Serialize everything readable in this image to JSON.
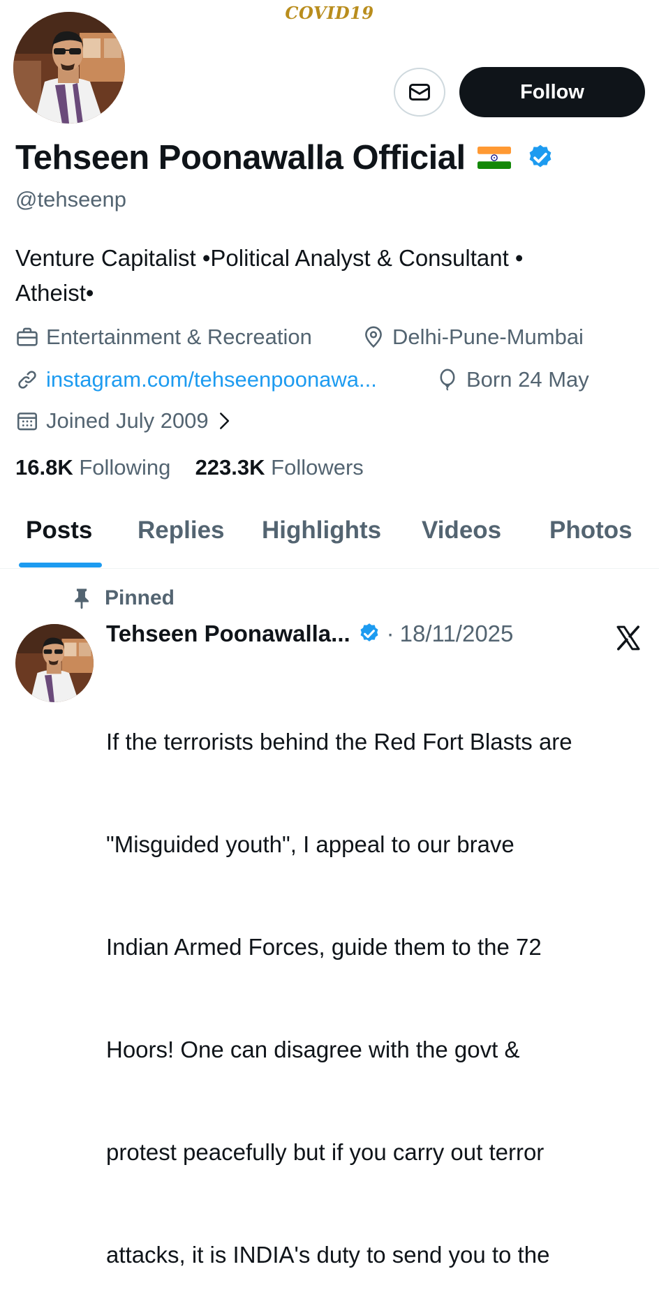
{
  "banner": {
    "text": "COVID19"
  },
  "profile": {
    "display_name": "Tehseen Poonawalla Official",
    "handle": "@tehseenp",
    "bio_line1": "Venture Capitalist •Political Analyst & Consultant •",
    "bio_line2": "Atheist•",
    "category": "Entertainment & Recreation",
    "location": "Delhi-Pune-Mumbai",
    "website": "instagram.com/tehseenpoonawa...",
    "birthday": "Born 24 May",
    "joined": "Joined July 2009",
    "following_count": "16.8K",
    "following_label": "Following",
    "followers_count": "223.3K",
    "followers_label": "Followers"
  },
  "actions": {
    "follow_label": "Follow",
    "message_icon": "envelope-icon"
  },
  "tabs": [
    {
      "label": "Posts",
      "active": true
    },
    {
      "label": "Replies",
      "active": false
    },
    {
      "label": "Highlights",
      "active": false
    },
    {
      "label": "Videos",
      "active": false
    },
    {
      "label": "Photos",
      "active": false
    }
  ],
  "post": {
    "pinned_label": "Pinned",
    "author": "Tehseen Poonawalla...",
    "separator": "·",
    "date": "18/11/2025",
    "text_lines": [
      "If the terrorists behind the Red Fort Blasts are",
      "\"Misguided youth\", I appeal to our brave",
      "Indian Armed Forces, guide them to the 72",
      "Hoors! One can disagree with the govt &",
      "protest peacefully but if you carry out terror",
      "attacks, it is INDIA's duty to send you to the"
    ]
  },
  "colors": {
    "accent": "#1d9bf0",
    "text": "#0f1419",
    "muted": "#536471",
    "banner_text": "#b98d1d"
  }
}
